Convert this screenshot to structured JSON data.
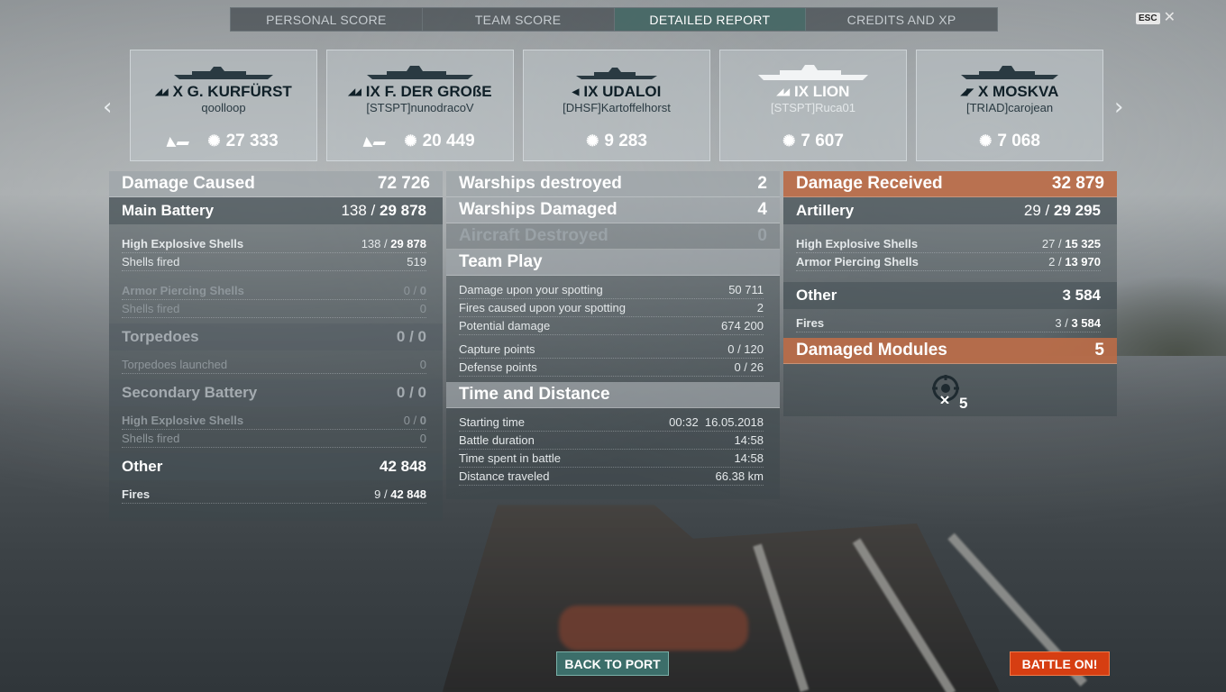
{
  "tabs": [
    {
      "label": "PERSONAL SCORE"
    },
    {
      "label": "TEAM SCORE"
    },
    {
      "label": "DETAILED REPORT"
    },
    {
      "label": "CREDITS AND XP"
    }
  ],
  "esc": {
    "key": "ESC",
    "close": "✕"
  },
  "nav": {
    "prev": "‹",
    "next": "›"
  },
  "ships": [
    {
      "tier_name": "X G. KURFÜRST",
      "player": "qoolloop",
      "score": "27 333",
      "class_icon": "battleship-icon"
    },
    {
      "tier_name": "IX F. DER GROßE",
      "player": "[STSPT]nunodracoV",
      "score": "20 449",
      "class_icon": "battleship-icon"
    },
    {
      "tier_name": "IX UDALOI",
      "player": "[DHSF]Kartoffelhorst",
      "score": "9 283",
      "class_icon": "destroyer-icon"
    },
    {
      "tier_name": "IX LION",
      "player": "[STSPT]Ruca01",
      "score": "7 607",
      "class_icon": "battleship-icon"
    },
    {
      "tier_name": "X MOSKVA",
      "player": "[TRIAD]carojean",
      "score": "7 068",
      "class_icon": "cruiser-icon"
    }
  ],
  "left": {
    "header": {
      "label": "Damage Caused",
      "value": "72 726"
    },
    "main_battery": {
      "label": "Main Battery",
      "hits": "138",
      "dmg": "29 878"
    },
    "mb_he": {
      "label": "High Explosive Shells",
      "hits": "138",
      "dmg": "29 878"
    },
    "mb_fired": {
      "label": "Shells fired",
      "value": "519"
    },
    "mb_ap": {
      "label": "Armor Piercing Shells",
      "hits": "0",
      "dmg": "0"
    },
    "mb_ap_fired": {
      "label": "Shells fired",
      "value": "0"
    },
    "torpedoes": {
      "label": "Torpedoes",
      "value": "0 / 0"
    },
    "torp_launched": {
      "label": "Torpedoes launched",
      "value": "0"
    },
    "secondary": {
      "label": "Secondary Battery",
      "value": "0 / 0"
    },
    "sec_he": {
      "label": "High Explosive Shells",
      "hits": "0",
      "dmg": "0"
    },
    "sec_fired": {
      "label": "Shells fired",
      "value": "0"
    },
    "other": {
      "label": "Other",
      "value": "42 848"
    },
    "fires": {
      "label": "Fires",
      "hits": "9",
      "dmg": "42 848"
    }
  },
  "middle": {
    "destroyed": {
      "label": "Warships destroyed",
      "value": "2"
    },
    "damaged": {
      "label": "Warships Damaged",
      "value": "4"
    },
    "aircraft": {
      "label": "Aircraft Destroyed",
      "value": "0"
    },
    "team_play": {
      "label": "Team Play"
    },
    "spotting_dmg": {
      "label": "Damage upon your spotting",
      "value": "50 711"
    },
    "spotting_fires": {
      "label": "Fires caused upon your spotting",
      "value": "2"
    },
    "potential": {
      "label": "Potential damage",
      "value": "674 200"
    },
    "capture": {
      "label": "Capture points",
      "value": "0 / 120"
    },
    "defense": {
      "label": "Defense points",
      "value": "0 / 26"
    },
    "time_distance": {
      "label": "Time and Distance"
    },
    "start": {
      "label": "Starting time",
      "value": "00:32  16.05.2018"
    },
    "duration": {
      "label": "Battle duration",
      "value": "14:58"
    },
    "spent": {
      "label": "Time spent in battle",
      "value": "14:58"
    },
    "distance": {
      "label": "Distance traveled",
      "value": "66.38 km"
    }
  },
  "right": {
    "header": {
      "label": "Damage Received",
      "value": "32 879"
    },
    "artillery": {
      "label": "Artillery",
      "hits": "29",
      "dmg": "29 295"
    },
    "art_he": {
      "label": "High Explosive Shells",
      "hits": "27",
      "dmg": "15 325"
    },
    "art_ap": {
      "label": "Armor Piercing Shells",
      "hits": "2",
      "dmg": "13 970"
    },
    "other": {
      "label": "Other",
      "value": "3 584"
    },
    "fires": {
      "label": "Fires",
      "hits": "3",
      "dmg": "3 584"
    },
    "modules": {
      "label": "Damaged Modules",
      "value": "5"
    },
    "module_count": "5"
  },
  "buttons": {
    "back": "BACK TO PORT",
    "battle": "BATTLE ON!"
  },
  "colors": {
    "accent_teal": "#3c6e6a",
    "battle_orange": "#d63e12",
    "received_header": "#c46e46"
  }
}
